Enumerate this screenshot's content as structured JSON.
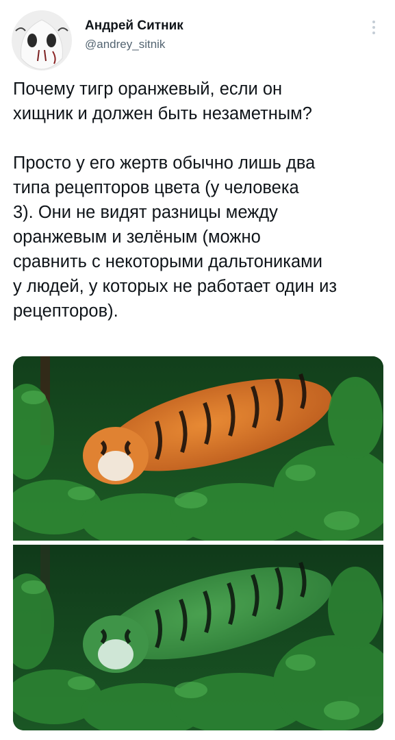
{
  "author": {
    "name": "Андрей Ситник",
    "handle": "@andrey_sitnik",
    "avatar_icon": "white-mask-avatar-icon"
  },
  "header": {
    "more_icon": "vertical-ellipsis-icon"
  },
  "tweet": {
    "paragraph_1": "Почему тигр оранжевый, если он\nхищник и должен быть незаметным?",
    "paragraph_2": "Просто у его жертв обычно лишь два\nтипа рецепторов цвета (у человека\n3). Они не видят разницы между\nоранжевым и зелёным (можно\nсравнить с некоторыми дальтониками\nу людей, у которых не работает один из\nрецепторов)."
  },
  "media": {
    "photo_top": "tiger-in-green-forest-orange-photo",
    "photo_bottom": "tiger-in-green-forest-color-shifted-photo",
    "colors": {
      "tiger_orange": "#d9782a",
      "tiger_green_shift": "#3f8f45",
      "foliage_dark": "#0e3d18",
      "foliage_light": "#2f7d33"
    }
  }
}
